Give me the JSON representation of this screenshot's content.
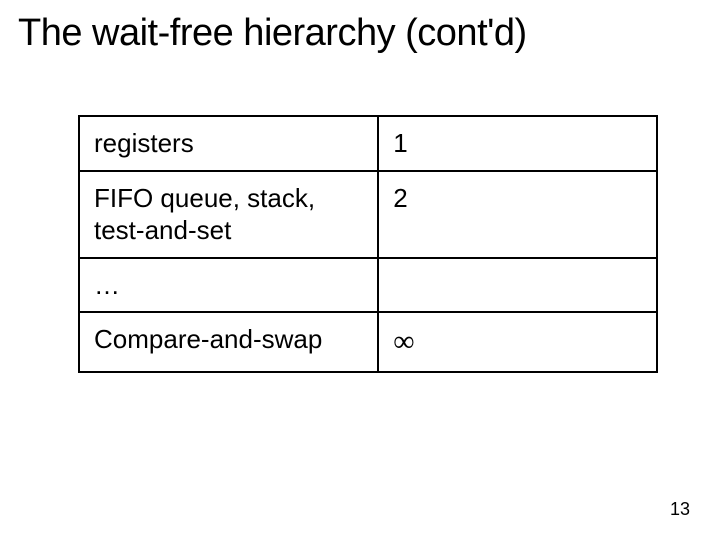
{
  "title": "The wait-free hierarchy (cont'd)",
  "table": {
    "rows": [
      {
        "label": "registers",
        "value": "1"
      },
      {
        "label": "FIFO queue, stack, test-and-set",
        "value": "2"
      },
      {
        "label": "…",
        "value": ""
      },
      {
        "label": "Compare-and-swap",
        "value": "∞"
      }
    ]
  },
  "page_number": "13"
}
